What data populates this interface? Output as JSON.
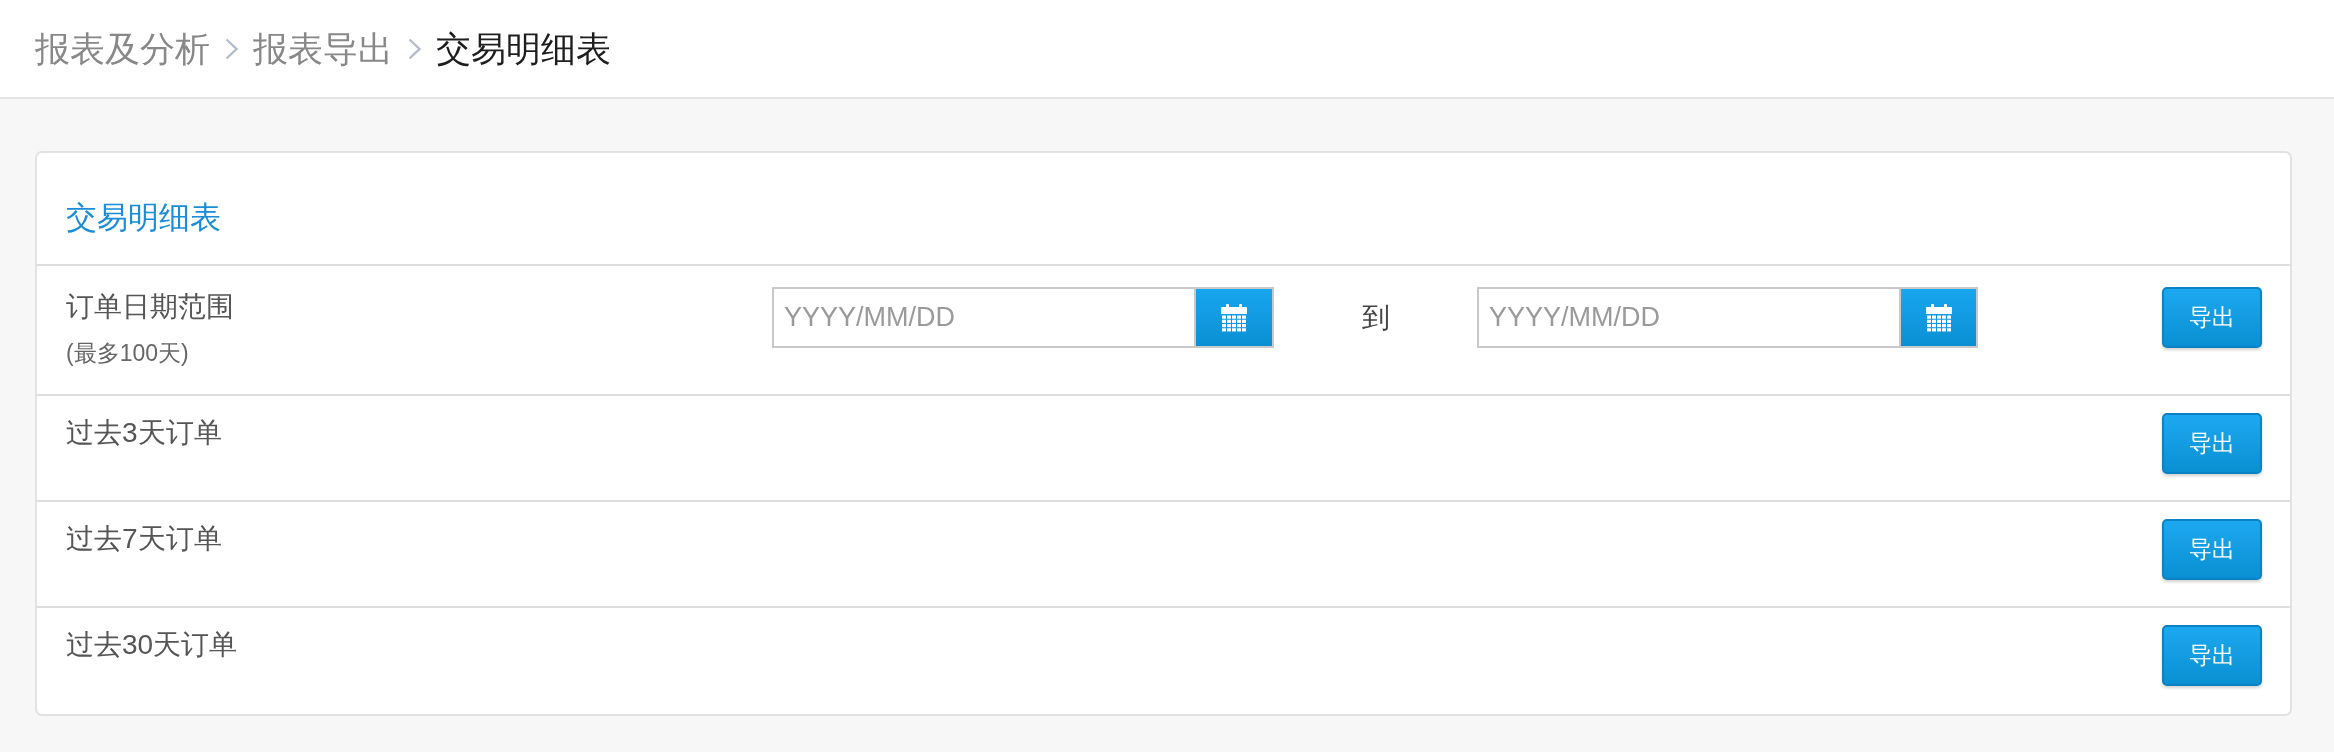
{
  "breadcrumb": [
    {
      "label": "报表及分析",
      "current": false
    },
    {
      "label": "报表导出",
      "current": false
    },
    {
      "label": "交易明细表",
      "current": true
    }
  ],
  "panel": {
    "title": "交易明细表",
    "rows": [
      {
        "kind": "date_range",
        "label": "订单日期范围",
        "note": "(最多100天)",
        "start": {
          "placeholder": "YYYY/MM/DD"
        },
        "separator": "到",
        "end": {
          "placeholder": "YYYY/MM/DD"
        },
        "button": "导出"
      },
      {
        "kind": "preset",
        "label": "过去3天订单",
        "button": "导出"
      },
      {
        "kind": "preset",
        "label": "过去7天订单",
        "button": "导出"
      },
      {
        "kind": "preset",
        "label": "过去30天订单",
        "button": "导出"
      }
    ]
  }
}
